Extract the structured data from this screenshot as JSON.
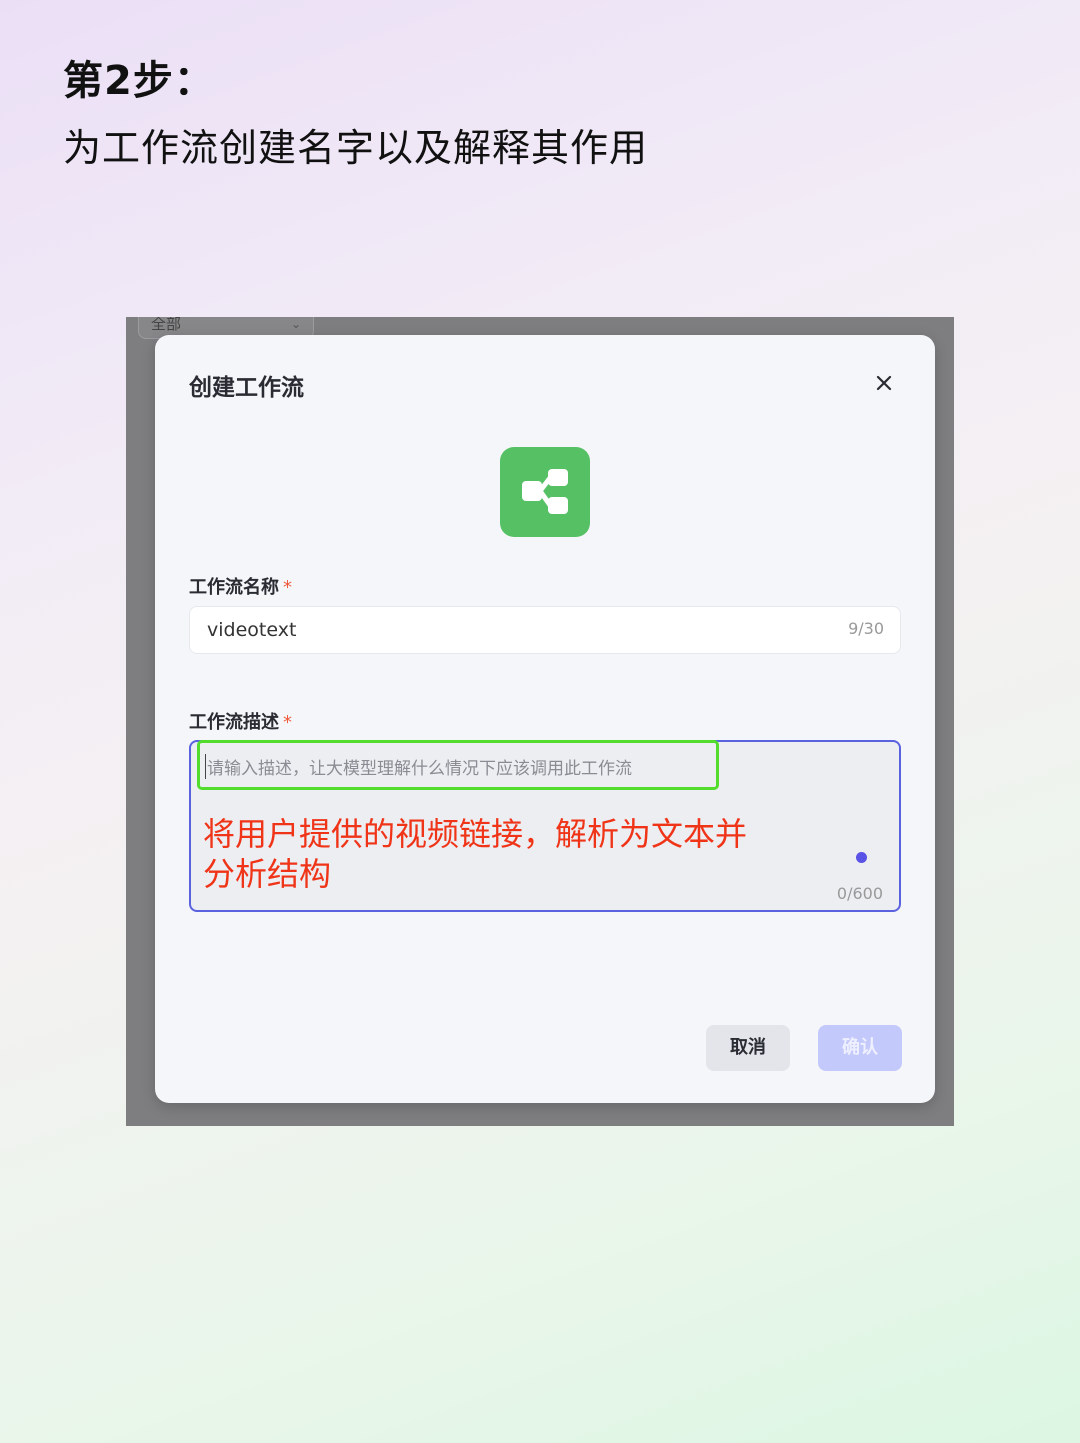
{
  "header": {
    "step_title": "第2步：",
    "step_subtitle": "为工作流创建名字以及解释其作用"
  },
  "background_app": {
    "filter_select_value": "全部"
  },
  "modal": {
    "title": "创建工作流",
    "close_icon": "close-icon",
    "workflow_icon": "workflow-icon",
    "name_field": {
      "label": "工作流名称",
      "required_mark": "*",
      "value": "videotext",
      "counter": "9/30"
    },
    "description_field": {
      "label": "工作流描述",
      "required_mark": "*",
      "placeholder": "请输入描述，让大模型理解什么情况下应该调用此工作流",
      "counter": "0/600"
    },
    "annotation": "将用户提供的视频链接，解析为文本并分析结构",
    "cancel_label": "取消",
    "confirm_label": "确认"
  },
  "colors": {
    "accent": "#5b62e0",
    "icon_green": "#56c164",
    "highlight_green": "#52dd2c",
    "annotation_red": "#f03418",
    "confirm_disabled": "#c4c9fb"
  }
}
